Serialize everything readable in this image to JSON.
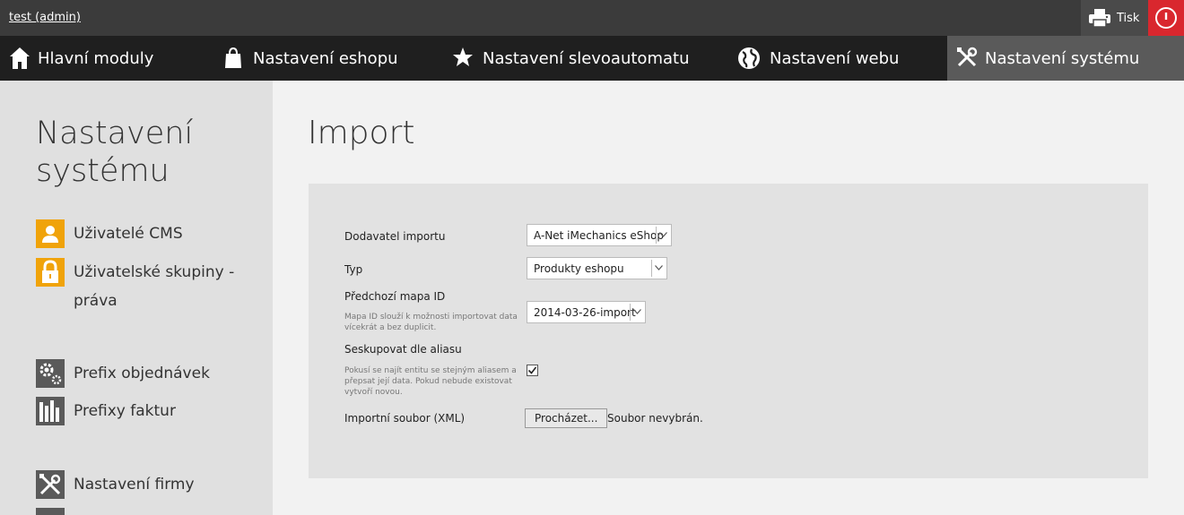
{
  "topbar": {
    "user_label": "test (admin)",
    "print_label": "Tisk",
    "print_icon": "printer-icon",
    "logout_icon": "power-icon",
    "logout_color": "#d9272e"
  },
  "mainnav": {
    "items": [
      {
        "label": "Hlavní moduly",
        "icon": "home-icon"
      },
      {
        "label": "Nastavení eshopu",
        "icon": "shopping-bag-icon"
      },
      {
        "label": "Nastavení slevoautomatu",
        "icon": "star-icon"
      },
      {
        "label": "Nastavení webu",
        "icon": "globe-icon"
      },
      {
        "label": "Nastavení systému",
        "icon": "tools-icon",
        "active": true
      }
    ]
  },
  "sidebar": {
    "title_line1": "Nastavení",
    "title_line2": "systému",
    "items": [
      {
        "label": "Uživatelé CMS",
        "icon": "user-icon",
        "color": "#f0a30a"
      },
      {
        "label": "Uživatelské skupiny - práva",
        "icon": "lock-icon",
        "color": "#f0a30a"
      },
      {
        "label": "Prefix objednávek",
        "icon": "gears-icon",
        "color": "#5a5a5a"
      },
      {
        "label": "Prefixy faktur",
        "icon": "bar-chart-icon",
        "color": "#5a5a5a"
      },
      {
        "label": "Nastavení firmy",
        "icon": "tools-icon",
        "color": "#5a5a5a"
      }
    ]
  },
  "main": {
    "title": "Import",
    "form": {
      "supplier_label": "Dodavatel importu",
      "supplier_value": "A-Net iMechanics eShop",
      "type_label": "Typ",
      "type_value": "Produkty eshopu",
      "prev_map_label": "Předchozí mapa ID",
      "prev_map_help": "Mapa ID slouží k možnosti importovat data vícekrát a bez duplicit.",
      "prev_map_value": "2014-03-26-import",
      "group_label": "Seskupovat dle aliasu",
      "group_help": "Pokusí se najít entitu se stejným aliasem a přepsat její data. Pokud nebude existovat vytvoří novou.",
      "group_checked": true,
      "file_label": "Importní soubor (XML)",
      "file_button": "Procházet...",
      "file_status": "Soubor nevybrán."
    }
  }
}
